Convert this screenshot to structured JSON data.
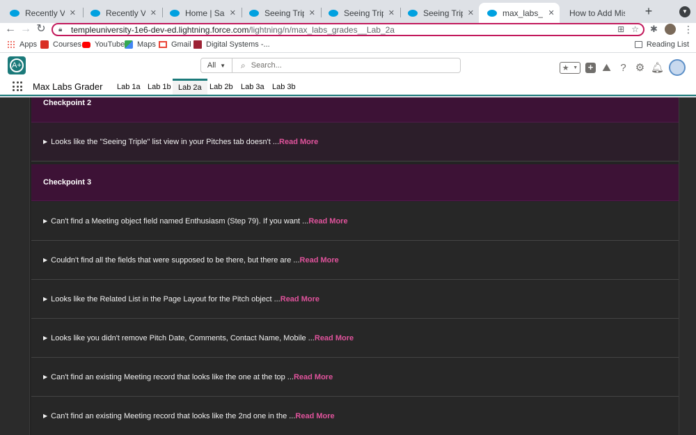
{
  "browser": {
    "tabs": [
      {
        "title": "Recently Viewed"
      },
      {
        "title": "Recently Viewed"
      },
      {
        "title": "Home | Salesforce"
      },
      {
        "title": "Seeing Triple | Pit"
      },
      {
        "title": "Seeing Triple | Pit"
      },
      {
        "title": "Seeing Triple | Pit"
      },
      {
        "title": "max_labs_grades"
      },
      {
        "title": "How to Add Missi"
      }
    ],
    "url_host": "templeuniversity-1e6-dev-ed.lightning.force.com",
    "url_path": "/lightning/n/max_labs_grades__Lab_2a",
    "bookmarks": [
      "Apps",
      "Courses",
      "YouTube",
      "Maps",
      "Gmail",
      "Digital Systems -..."
    ],
    "reading_list": "Reading List"
  },
  "sf": {
    "search_scope": "All",
    "search_placeholder": "Search...",
    "app_name": "Max Labs Grader",
    "nav_tabs": [
      "Lab 1a",
      "Lab 1b",
      "Lab 2a",
      "Lab 2b",
      "Lab 3a",
      "Lab 3b"
    ],
    "active_tab": "Lab 2a"
  },
  "grades": {
    "read_more": "Read More",
    "checkpoint2": {
      "title": "Checkpoint 2",
      "items": [
        "Looks like the \"Seeing Triple\" list view in your Pitches tab doesn't ..."
      ]
    },
    "checkpoint3": {
      "title": "Checkpoint 3",
      "items": [
        "Can't find a Meeting object field named Enthusiasm (Step 79). If you want ...",
        "Couldn't find all the fields that were supposed to be there, but there are ...",
        "Looks like the Related List in the Page Layout for the Pitch object ...",
        "Looks like you didn't remove Pitch Date, Comments, Contact Name, Mobile ...",
        "Can't find an existing Meeting record that looks like the one at the top ...",
        "Can't find an existing Meeting record that looks like the 2nd one in the ..."
      ]
    }
  },
  "colors": {
    "checkpoint_bg": "#3d1236",
    "read_more": "#e0539c",
    "brand": "#1b7a7a",
    "omnibox_border": "#c2185b"
  }
}
